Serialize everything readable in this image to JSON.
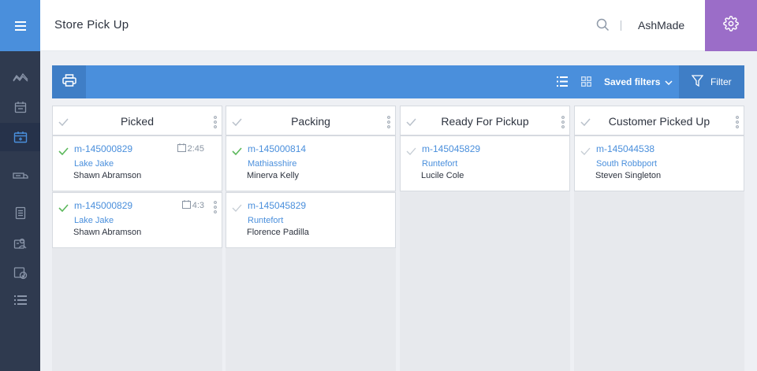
{
  "app": {
    "title": "Store Pick Up",
    "user": "AshMade"
  },
  "sidebar": {
    "items": [
      {
        "icon": "analytics-icon"
      },
      {
        "icon": "calendar-icon"
      },
      {
        "icon": "store-pickup-icon",
        "active": true
      },
      {
        "icon": "shipping-icon"
      },
      {
        "icon": "document-icon"
      },
      {
        "icon": "users-icon"
      },
      {
        "icon": "returns-icon"
      },
      {
        "icon": "list-icon"
      }
    ]
  },
  "toolbar": {
    "saved_filters_label": "Saved filters",
    "filter_label": "Filter"
  },
  "columns": [
    {
      "title": "Picked",
      "cards": [
        {
          "order_id": "m-145000829",
          "location": "Lake Jake",
          "customer": "Shawn Abramson",
          "time": "2:45",
          "status": "done"
        },
        {
          "order_id": "m-145000829",
          "location": "Lake Jake",
          "customer": "Shawn Abramson",
          "time": "4:3",
          "status": "done"
        }
      ]
    },
    {
      "title": "Packing",
      "cards": [
        {
          "order_id": "m-145000814",
          "location": "Mathiasshire",
          "customer": "Minerva Kelly",
          "status": "done"
        },
        {
          "order_id": "m-145045829",
          "location": "Runtefort",
          "customer": "Florence Padilla",
          "status": "pending"
        }
      ]
    },
    {
      "title": "Ready For Pickup",
      "cards": [
        {
          "order_id": "m-145045829",
          "location": "Runtefort",
          "customer": "Lucile Cole",
          "status": "pending"
        }
      ]
    },
    {
      "title": "Customer Picked Up",
      "cards": [
        {
          "order_id": "m-145044538",
          "location": "South Robbport",
          "customer": "Steven Singleton",
          "status": "pending"
        }
      ]
    }
  ],
  "colors": {
    "accent": "#4a8fdc",
    "accent_dark": "#3f7ec6",
    "sidebar": "#2f3a4f",
    "settings": "#9b6dc8",
    "check_done": "#5cb85c",
    "check_pending": "#c5ccd4"
  }
}
